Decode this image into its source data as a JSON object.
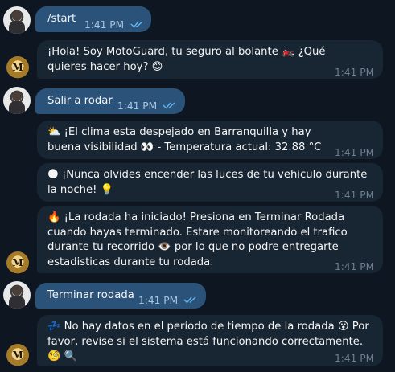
{
  "messages": [
    {
      "id": "m1",
      "from": "user",
      "text": "/start",
      "time": "1:41 PM"
    },
    {
      "id": "m2",
      "from": "bot",
      "text": "¡Hola! Soy MotoGuard, tu seguro al bolante 🏍️ ¿Qué quieres hacer hoy? 😊",
      "time": "1:41 PM"
    },
    {
      "id": "m3",
      "from": "user",
      "text": "Salir a rodar",
      "time": "1:41 PM"
    },
    {
      "id": "m4",
      "from": "bot",
      "text": "⛅ ¡El clima esta despejado en Barranquilla y hay buena visibilidad 👀 - Temperatura actual: 32.88 °C",
      "time": "1:41 PM"
    },
    {
      "id": "m5",
      "from": "bot",
      "text": "🌑 ¡Nunca olvides encender las luces de tu vehiculo durante la noche! 💡",
      "time": "1:41 PM"
    },
    {
      "id": "m6",
      "from": "bot",
      "text": "🔥 ¡La rodada ha iniciado! Presiona en Terminar Rodada cuando hayas terminado. Estare monitoreando el trafico durante tu recorrido 👁️ por lo que no podre entregarte estadisticas durante tu rodada.",
      "time": "1:41 PM"
    },
    {
      "id": "m7",
      "from": "user",
      "text": "Terminar rodada",
      "time": "1:41 PM"
    },
    {
      "id": "m8",
      "from": "bot",
      "text": "💤 No hay datos en el período de tiempo de la rodada 😮 Por favor, revise si el sistema está funcionando correctamente. 🧐 🔍",
      "time": "1:41 PM"
    }
  ],
  "bot_avatar_letter": "M",
  "colors": {
    "background": "#0e1621",
    "outgoing_bubble": "#2b5278",
    "incoming_bubble": "#182533",
    "read_check": "#5fb6f5"
  },
  "icons": {
    "read_receipt": "double-check-icon"
  }
}
